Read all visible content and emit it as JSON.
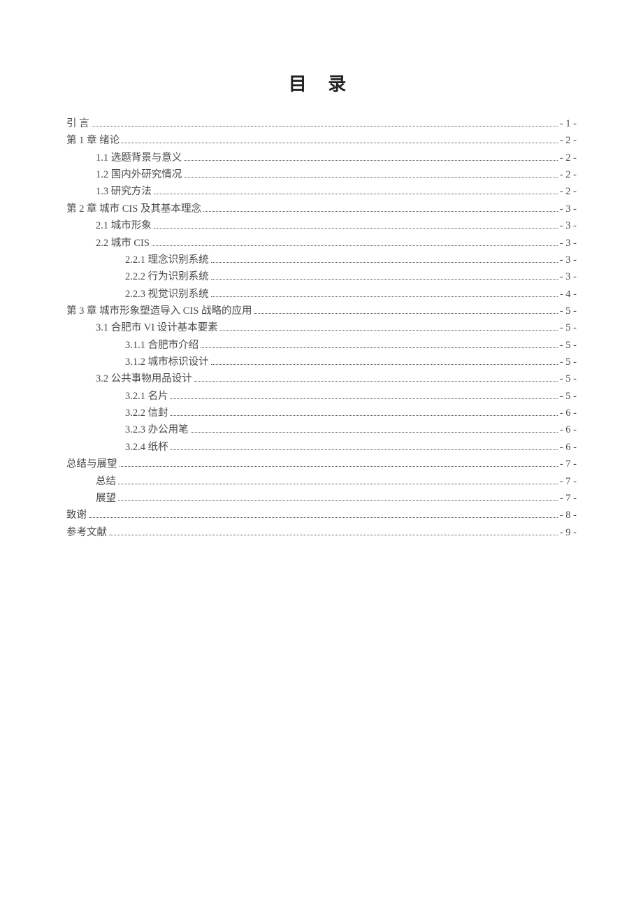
{
  "title": "目 录",
  "entries": [
    {
      "label": "引  言",
      "page": "- 1 -",
      "level": 0
    },
    {
      "label": "第 1 章  绪论",
      "page": "- 2 -",
      "level": 0
    },
    {
      "label": "1.1 选题背景与意义",
      "page": "- 2 -",
      "level": 1
    },
    {
      "label": "1.2 国内外研究情况",
      "page": "- 2 -",
      "level": 1
    },
    {
      "label": "1.3 研究方法",
      "page": "- 2 -",
      "level": 1
    },
    {
      "label": "第 2 章  城市 CIS 及其基本理念",
      "page": "- 3 -",
      "level": 0
    },
    {
      "label": "2.1  城市形象",
      "page": "- 3 -",
      "level": 1
    },
    {
      "label": "2.2  城市 CIS",
      "page": "- 3 -",
      "level": 1
    },
    {
      "label": "2.2.1 理念识别系统",
      "page": "- 3 -",
      "level": 2
    },
    {
      "label": "2.2.2 行为识别系统",
      "page": "- 3 -",
      "level": 2
    },
    {
      "label": "2.2.3 视觉识别系统",
      "page": "- 4 -",
      "level": 2
    },
    {
      "label": "第 3 章  城市形象塑造导入 CIS 战略的应用",
      "page": "- 5 -",
      "level": 0
    },
    {
      "label": "3.1 合肥市 VI 设计基本要素",
      "page": "- 5 -",
      "level": 1
    },
    {
      "label": "3.1.1 合肥市介绍",
      "page": "- 5 -",
      "level": 2
    },
    {
      "label": "3.1.2 城市标识设计",
      "page": "- 5 -",
      "level": 2
    },
    {
      "label": "3.2 公共事物用品设计",
      "page": "- 5 -",
      "level": 1
    },
    {
      "label": "3.2.1 名片",
      "page": "- 5 -",
      "level": 2
    },
    {
      "label": "3.2.2 信封",
      "page": "- 6 -",
      "level": 2
    },
    {
      "label": "3.2.3 办公用笔",
      "page": "- 6 -",
      "level": 2
    },
    {
      "label": "3.2.4 纸杯",
      "page": "- 6 -",
      "level": 2
    },
    {
      "label": "总结与展望",
      "page": "- 7 -",
      "level": 0
    },
    {
      "label": "总结",
      "page": "- 7 -",
      "level": 1
    },
    {
      "label": "展望",
      "page": "- 7 -",
      "level": 1
    },
    {
      "label": "致谢",
      "page": "- 8 -",
      "level": 0
    },
    {
      "label": "参考文献",
      "page": "- 9 -",
      "level": 0
    }
  ]
}
